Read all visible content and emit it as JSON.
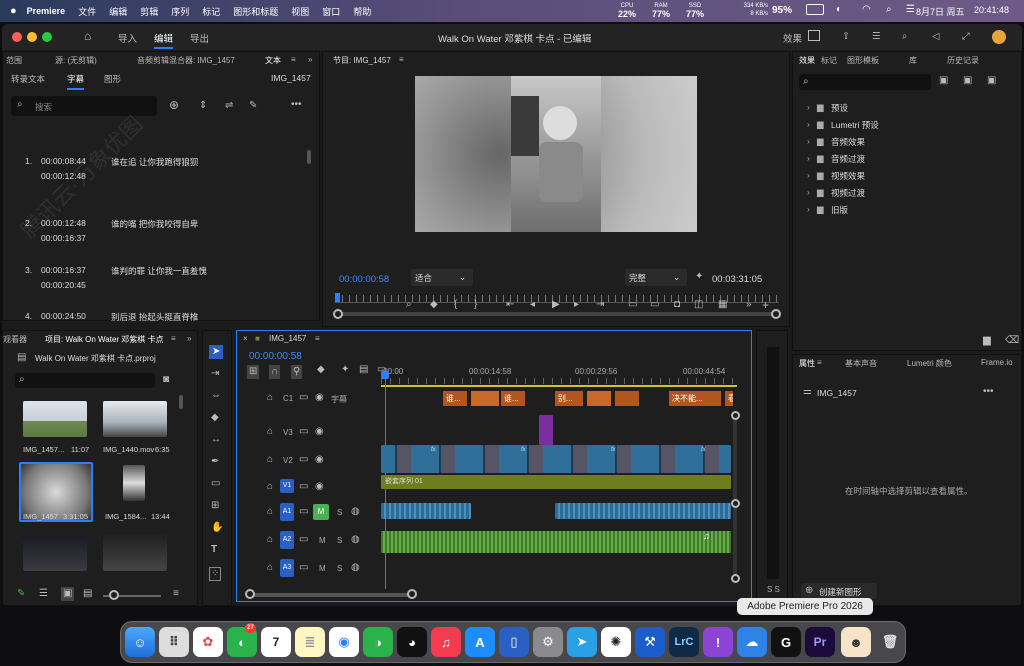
{
  "menubar": {
    "app": "Premiere",
    "items": [
      "文件",
      "编辑",
      "剪辑",
      "序列",
      "标记",
      "图形和标题",
      "视图",
      "窗口",
      "帮助"
    ],
    "cpu_label": "CPU",
    "cpu": "22%",
    "ram_label": "RAM",
    "ram": "77%",
    "ssd_label": "SSD",
    "ssd": "77%",
    "net_up": "334 KB/s",
    "net_down": "8 KB/s",
    "battery": "95%",
    "date": "8月7日 周五",
    "time": "20:41:48"
  },
  "titlebar": {
    "home": "⌂",
    "tabs": [
      "导入",
      "编辑",
      "导出"
    ],
    "title": "Walk On Water 邓紫棋 卡点 - 已编辑",
    "effects": "效果"
  },
  "text_panel": {
    "tabs_top": [
      "音频剪辑混合器: IMG_1457",
      "文本"
    ],
    "left_crumb": "范围",
    "source": "源: (无剪辑)",
    "tabs": [
      "转录文本",
      "字幕",
      "图形"
    ],
    "clip": "IMG_1457",
    "search_placeholder": "搜索",
    "captions": [
      {
        "n": "1.",
        "in": "00:00:08:44",
        "out": "00:00:12:48",
        "text": "谁在追 让你我跑得狼狈"
      },
      {
        "n": "2.",
        "in": "00:00:12:48",
        "out": "00:00:16:37",
        "text": "谁的嘴 把你我咬得自卑"
      },
      {
        "n": "3.",
        "in": "00:00:16:37",
        "out": "00:00:20:45",
        "text": "谁判的罪 让你我一直羞愧"
      },
      {
        "n": "4.",
        "in": "00:00:24:50",
        "out": "",
        "text": "别后退 抬起头挺直脊椎"
      }
    ]
  },
  "program": {
    "label": "节目: IMG_1457",
    "timecode": "00:00:00:58",
    "fit": "适合",
    "quality": "完整",
    "duration": "00:03:31:05"
  },
  "effects_panel": {
    "tabs": [
      "效果",
      "标记",
      "图形模板",
      "库",
      "历史记录"
    ],
    "folders": [
      "预设",
      "Lumetri 预设",
      "音频效果",
      "音频过渡",
      "视频效果",
      "视频过渡",
      "旧版"
    ]
  },
  "project": {
    "tab": "项目: Walk On Water 邓紫棋 卡点",
    "left": "观看器",
    "file": "Walk On Water 邓紫棋 卡点.prproj",
    "items": [
      {
        "name": "IMG_1457...",
        "dur": "11:07"
      },
      {
        "name": "IMG_1440.mov",
        "dur": "6:35"
      },
      {
        "name": "IMG_1457",
        "dur": "3:31:05"
      },
      {
        "name": "IMG_1584...",
        "dur": "13:44"
      }
    ]
  },
  "timeline": {
    "tab": "IMG_1457",
    "timecode": "00:00:00:58",
    "ruler": [
      ":00:00",
      "00:00:14:58",
      "00:00:29:56",
      "00:00:44:54"
    ],
    "tracks": [
      "C1",
      "V3",
      "V2",
      "V1",
      "A1",
      "A2",
      "A3"
    ],
    "caption_label": "字幕",
    "captions": [
      "谁...",
      "谁...",
      "别...",
      "决不能...",
      "看"
    ],
    "seq_label": "嵌套序列 01",
    "fx": "fx",
    "m": "M",
    "s": "S"
  },
  "properties": {
    "tabs": [
      "属性",
      "基本声音",
      "Lumetri 颜色",
      "Frame.io"
    ],
    "clip": "IMG_1457",
    "hint": "在时间轴中选择剪辑以查看属性。",
    "create": "创建新图形"
  },
  "meter": {
    "s": "S S"
  },
  "dock": {
    "tooltip": "Adobe Premiere Pro 2026",
    "badge": "27",
    "cal_day": "7",
    "lrc": "LrC",
    "pr": "Pr"
  },
  "watermark": "腾讯云·万象优图",
  "colors": {
    "accent": "#2a5fc4",
    "caption": "#b2561f",
    "video": "#2f6f9a",
    "audio": "#4f8f3a",
    "purple": "#7a2fa0"
  }
}
